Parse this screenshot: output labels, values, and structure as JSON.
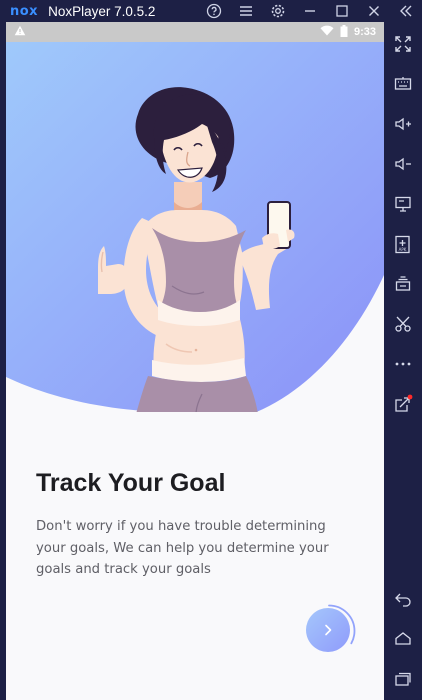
{
  "window": {
    "logo_text": "nox",
    "title": "NoxPlayer 7.0.5.2",
    "controls": [
      "help-icon",
      "menu-icon",
      "settings-icon",
      "minimize-icon",
      "maximize-icon",
      "close-icon",
      "collapse-icon"
    ]
  },
  "statusbar": {
    "time": "9:33",
    "icons": [
      "warning-icon",
      "wifi-icon",
      "battery-icon"
    ]
  },
  "onboarding": {
    "headline": "Track Your Goal",
    "description": "Don't worry if you have trouble determining your goals, We can help you determine your goals and track your goals",
    "progress": 0.33
  },
  "sidebar": {
    "tools": [
      "fullscreen-icon",
      "keyboard-icon",
      "volume-up-icon",
      "volume-down-icon",
      "screen-icon",
      "apk-install-icon",
      "multi-instance-icon",
      "screenshot-cut-icon",
      "more-icon",
      "external-link-icon"
    ],
    "nav": [
      "back-icon",
      "home-icon",
      "recents-icon"
    ]
  },
  "colors": {
    "chrome": "#1d2045",
    "gradient_start": "#9cc4fb",
    "gradient_end": "#8a94f9",
    "accent": "#92a3fb",
    "headline": "#1d1d21"
  }
}
